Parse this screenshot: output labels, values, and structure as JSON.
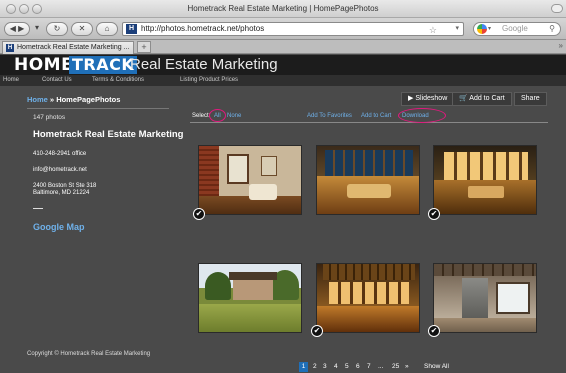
{
  "window": {
    "title": "Hometrack Real Estate Marketing | HomePagePhotos"
  },
  "browser": {
    "url": "http://photos.hometrack.net/photos",
    "search_placeholder": "Google",
    "tab_label": "Hometrack Real Estate Marketing ...",
    "new_tab": "+",
    "tab_icon_letter": "H"
  },
  "site": {
    "logo_part1": "HOME",
    "logo_part2": "TRACK",
    "logo_part3": "Real Estate Marketing",
    "nav": [
      "Home",
      "Contact Us",
      "Terms & Conditions",
      "Listing Product Prices"
    ]
  },
  "sidebar": {
    "breadcrumb_home": "Home",
    "breadcrumb_sep": " » ",
    "breadcrumb_page": "HomePagePhotos",
    "photo_count": "147 photos",
    "company": "Hometrack Real Estate Marketing",
    "phone": "410-248-2941 office",
    "email": "info@hometrack.net",
    "address1": "2400 Boston St Ste 318",
    "address2": "Baltimore, MD 21224",
    "map_link": "Google Map",
    "copyright": "Copyright © Hometrack Real Estate Marketing"
  },
  "toolbar": {
    "slideshow": "Slideshow",
    "add_to_cart": "Add to Cart",
    "share": "Share",
    "select_label": "Select:",
    "select_all": "All",
    "select_none": "None",
    "add_favorites": "Add To Favorites",
    "add_cart_link": "Add to Cart",
    "download": "Download"
  },
  "photos": [
    {
      "checked": true
    },
    {
      "checked": false
    },
    {
      "checked": true
    },
    {
      "checked": false
    },
    {
      "checked": true
    },
    {
      "checked": true
    }
  ],
  "pagination": {
    "current": "1",
    "pages": [
      "2",
      "3",
      "4",
      "5",
      "6",
      "7"
    ],
    "ellipsis": "...",
    "last": "25",
    "next": "»",
    "show_all": "Show All"
  },
  "colors": {
    "accent": "#1f6fb8",
    "link": "#6fb1ea",
    "highlight": "#e0197e",
    "background": "#4a4a4a"
  }
}
